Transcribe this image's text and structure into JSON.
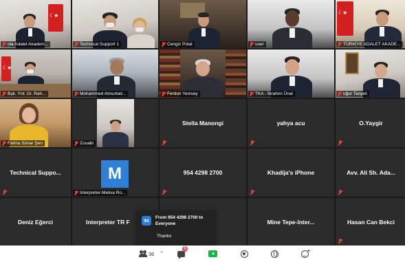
{
  "gallery": {
    "tiles": [
      {
        "label": "ola Adalet Akadem..."
      },
      {
        "label": "Technical Support 1"
      },
      {
        "label": "Cengiz Polat"
      },
      {
        "label": "user"
      },
      {
        "label": "TÜRKİYE ADALET AKADE..."
      },
      {
        "label": "Bşk. Yrd. Dr. Rah..."
      },
      {
        "label": "Mohammed Almurtad..."
      },
      {
        "label": "Ferdun Yenisey"
      },
      {
        "label": "TKA - İbrahim Ünal"
      },
      {
        "label": "uğur Tanyeli"
      },
      {
        "label": "Fatma Sünar Şen"
      },
      {
        "label": "Zouabi"
      },
      {
        "label": "Stella Manongi"
      },
      {
        "label": "yahya acu"
      },
      {
        "label": "O.Yaygir"
      },
      {
        "label": "Technical Suppo..."
      },
      {
        "label": "Interpreter-Melisa Ro..."
      },
      {
        "label": "954 4298 2700"
      },
      {
        "label": "Khadija's iPhone"
      },
      {
        "label": "Avv. Ali Sh. Ada..."
      },
      {
        "label": "Deniz Eğerci"
      },
      {
        "label": "Interpreter TR F"
      },
      {
        "label": "Mine  Tepe-Inter..."
      },
      {
        "label": "Hasan Can Bekci"
      }
    ],
    "avatar_letter": "M"
  },
  "chat_toast": {
    "avatar": "94",
    "title": "From 954 4298 2700 to Everyone",
    "message": "Thanks"
  },
  "toolbar": {
    "participants_count": "36",
    "chat_badge": "5",
    "chevron": "^"
  },
  "colors": {
    "mic_muted": "#e23c3c",
    "share": "#16b64a",
    "avatar_blue": "#2f80d9",
    "badge": "#e34f4f"
  }
}
